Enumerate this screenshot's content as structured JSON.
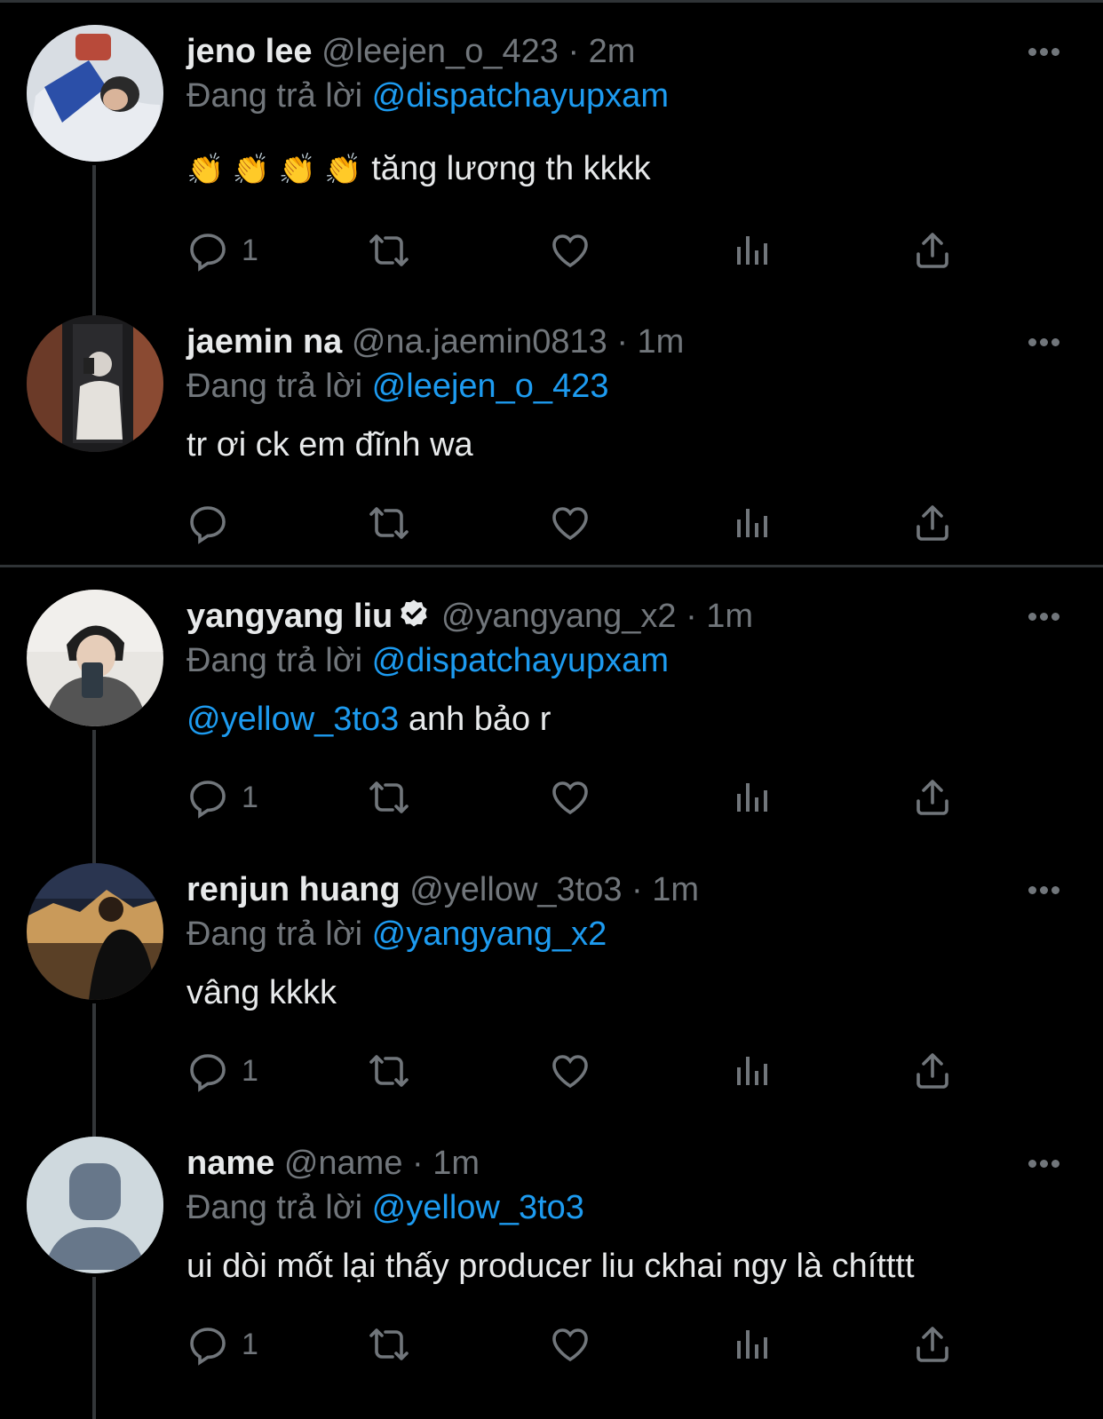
{
  "tweets": [
    {
      "name": "jeno lee",
      "handle": "@leejen_o_423",
      "dot": "·",
      "time": "2m",
      "reply_prefix": "Đang trả lời",
      "reply_to": "@dispatchayupxam",
      "body_prefix": "",
      "body_mention": "",
      "body_emoji": "👏 👏 👏 👏",
      "body_text": "tăng lương th kkkk",
      "reply_count": "1"
    },
    {
      "name": "jaemin na",
      "handle": "@na.jaemin0813",
      "dot": "·",
      "time": "1m",
      "reply_prefix": "Đang trả lời",
      "reply_to": "@leejen_o_423",
      "body_mention": "",
      "body_text": "tr ơi ck em đĩnh wa",
      "reply_count": ""
    },
    {
      "name": "yangyang liu",
      "verified": true,
      "handle": "@yangyang_x2",
      "dot": "·",
      "time": "1m",
      "reply_prefix": "Đang trả lời",
      "reply_to": "@dispatchayupxam",
      "body_mention": "@yellow_3to3",
      "body_text": "anh bảo r",
      "reply_count": "1"
    },
    {
      "name": "renjun huang",
      "handle": "@yellow_3to3",
      "dot": "·",
      "time": "1m",
      "reply_prefix": "Đang trả lời",
      "reply_to": "@yangyang_x2",
      "body_mention": "",
      "body_text": "vâng kkkk",
      "reply_count": "1"
    },
    {
      "name": "name",
      "handle": "@name",
      "dot": "·",
      "time": "1m",
      "reply_prefix": "Đang trả lời",
      "reply_to": "@yellow_3to3",
      "body_mention": "",
      "body_text": "ui dòi mốt lại thấy producer liu ckhai ngy là chítttt",
      "reply_count": "1"
    }
  ],
  "colors": {
    "background": "#000000",
    "text": "#e7e9ea",
    "muted": "#71767b",
    "accent": "#1d9bf0",
    "divider": "#2f3336"
  },
  "icons": {
    "reply": "reply-icon",
    "retweet": "retweet-icon",
    "like": "heart-icon",
    "views": "views-icon",
    "share": "share-icon",
    "more": "more-icon",
    "verified": "verified-badge-icon"
  }
}
